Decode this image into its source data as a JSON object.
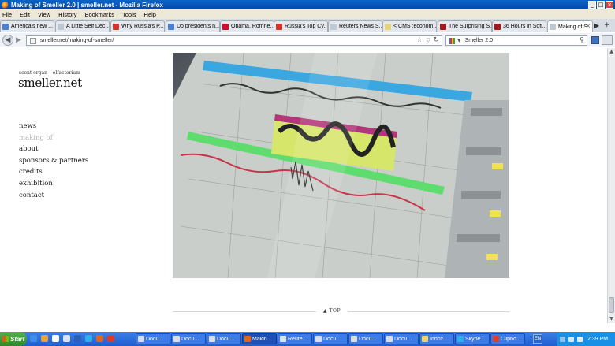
{
  "window": {
    "title": "Making of Smeller 2.0 | smeller.net - Mozilla Firefox",
    "controls": [
      "minimize",
      "maximize",
      "close"
    ]
  },
  "menubar": {
    "items": [
      "File",
      "Edit",
      "View",
      "History",
      "Bookmarks",
      "Tools",
      "Help"
    ]
  },
  "tabs": [
    {
      "label": "America's new ...",
      "icon": "globe-icon",
      "color": "#4a7fd6"
    },
    {
      "label": "A Little Self Dec...",
      "icon": "page-icon",
      "color": "#c0c8d4"
    },
    {
      "label": "Why Russia's P...",
      "icon": "tumblr-icon",
      "color": "#d1352b"
    },
    {
      "label": "Do presidents n...",
      "icon": "globe-icon",
      "color": "#4a7fd6"
    },
    {
      "label": "Obama, Romne...",
      "icon": "ap-icon",
      "color": "#c8102e"
    },
    {
      "label": "Russia's Top Cy...",
      "icon": "w-icon",
      "color": "#d1352b"
    },
    {
      "label": "Reuters News S...",
      "icon": "page-icon",
      "color": "#c0c8d4"
    },
    {
      "label": "< CMS :econom...",
      "icon": "folder-icon",
      "color": "#e9d27a"
    },
    {
      "label": "The Surprising S...",
      "icon": "nyt-icon",
      "color": "#a11a1a"
    },
    {
      "label": "36 Hours in Sofi...",
      "icon": "nyt-icon",
      "color": "#a11a1a"
    },
    {
      "label": "Making of S...",
      "icon": "page-icon",
      "color": "#c0c8d4",
      "active": true
    }
  ],
  "navbar": {
    "url": "smeller.net/making-of-smeller/",
    "search_text": "Smeller 2.0"
  },
  "site": {
    "tagline": "scent organ – olfactorium",
    "title": "smeller.net",
    "nav": [
      "news",
      "making of",
      "about",
      "sponsors & partners",
      "credits",
      "exhibition",
      "contact"
    ],
    "current_nav": "making of",
    "top_link": "▲ TOP"
  },
  "taskbar": {
    "start_label": "Start",
    "quick_launch": [
      {
        "icon": "ie-icon",
        "color": "#3c8ee8"
      },
      {
        "icon": "media-icon",
        "color": "#e9a23b"
      },
      {
        "icon": "outlook-icon",
        "color": "#ffffff"
      },
      {
        "icon": "pen-icon",
        "color": "#d8e4f5"
      },
      {
        "icon": "word-icon",
        "color": "#2b5fb8"
      },
      {
        "icon": "skype-icon",
        "color": "#2bb0e8"
      },
      {
        "icon": "firefox-icon",
        "color": "#e0661b"
      },
      {
        "icon": "record-icon",
        "color": "#e03a2a"
      }
    ],
    "tasks": [
      {
        "label": "Docu...",
        "icon": "doc-icon",
        "color": "#d9dee8"
      },
      {
        "label": "Docu...",
        "icon": "doc-icon",
        "color": "#d9dee8"
      },
      {
        "label": "Docu...",
        "icon": "doc-icon",
        "color": "#d9dee8"
      },
      {
        "label": "Makin...",
        "icon": "firefox-icon",
        "color": "#e0661b",
        "active": true
      },
      {
        "label": "Reute...",
        "icon": "pen-icon",
        "color": "#d8e4f5"
      },
      {
        "label": "Docu...",
        "icon": "doc-icon",
        "color": "#d9dee8"
      },
      {
        "label": "Docu...",
        "icon": "doc-icon",
        "color": "#d9dee8"
      },
      {
        "label": "Docu...",
        "icon": "doc-icon",
        "color": "#d9dee8"
      },
      {
        "label": "Inbox ...",
        "icon": "mail-icon",
        "color": "#f2d16b"
      },
      {
        "label": "Skype...",
        "icon": "skype-icon",
        "color": "#2bb0e8"
      },
      {
        "label": "Clipbo...",
        "icon": "clipboard-icon",
        "color": "#e23c2a"
      }
    ],
    "language": "EN",
    "clock": "2:39 PM"
  }
}
